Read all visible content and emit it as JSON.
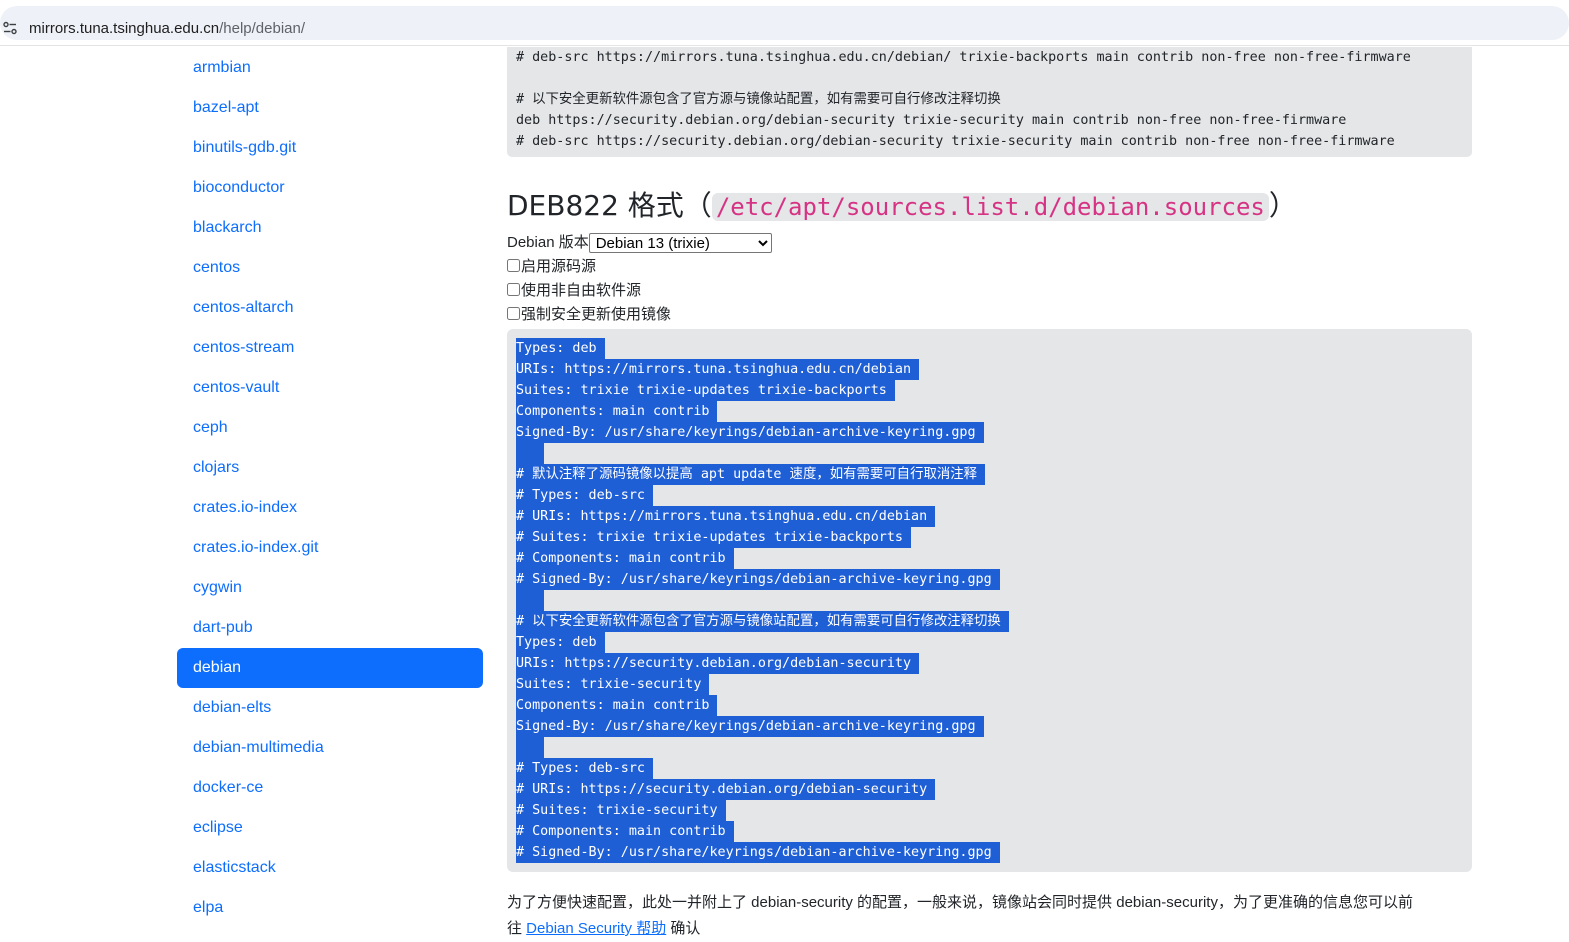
{
  "browser": {
    "url_host": "mirrors.tuna.tsinghua.edu.cn",
    "url_path": "/help/debian/"
  },
  "sidebar": {
    "items": [
      {
        "label": "armbian",
        "active": false
      },
      {
        "label": "bazel-apt",
        "active": false
      },
      {
        "label": "binutils-gdb.git",
        "active": false
      },
      {
        "label": "bioconductor",
        "active": false
      },
      {
        "label": "blackarch",
        "active": false
      },
      {
        "label": "centos",
        "active": false
      },
      {
        "label": "centos-altarch",
        "active": false
      },
      {
        "label": "centos-stream",
        "active": false
      },
      {
        "label": "centos-vault",
        "active": false
      },
      {
        "label": "ceph",
        "active": false
      },
      {
        "label": "clojars",
        "active": false
      },
      {
        "label": "crates.io-index",
        "active": false
      },
      {
        "label": "crates.io-index.git",
        "active": false
      },
      {
        "label": "cygwin",
        "active": false
      },
      {
        "label": "dart-pub",
        "active": false
      },
      {
        "label": "debian",
        "active": true
      },
      {
        "label": "debian-elts",
        "active": false
      },
      {
        "label": "debian-multimedia",
        "active": false
      },
      {
        "label": "docker-ce",
        "active": false
      },
      {
        "label": "eclipse",
        "active": false
      },
      {
        "label": "elasticstack",
        "active": false
      },
      {
        "label": "elpa",
        "active": false
      }
    ]
  },
  "top_code": {
    "lines": [
      "# deb-src https://mirrors.tuna.tsinghua.edu.cn/debian/ trixie-backports main contrib non-free non-free-firmware",
      "",
      "# 以下安全更新软件源包含了官方源与镜像站配置，如有需要可自行修改注释切换",
      "deb https://security.debian.org/debian-security trixie-security main contrib non-free non-free-firmware",
      "# deb-src https://security.debian.org/debian-security trixie-security main contrib non-free non-free-firmware"
    ]
  },
  "deb822": {
    "heading_prefix": "DEB822 格式（",
    "heading_path": "/etc/apt/sources.list.d/debian.sources",
    "heading_suffix": "）",
    "version_label": "Debian 版本",
    "version_selected": "Debian 13 (trixie)",
    "checkboxes": [
      {
        "label": "启用源码源",
        "checked": false
      },
      {
        "label": "使用非自由软件源",
        "checked": false
      },
      {
        "label": "强制安全更新使用镜像",
        "checked": false
      }
    ],
    "code_lines": [
      "Types: deb",
      "URIs: https://mirrors.tuna.tsinghua.edu.cn/debian",
      "Suites: trixie trixie-updates trixie-backports",
      "Components: main contrib",
      "Signed-By: /usr/share/keyrings/debian-archive-keyring.gpg",
      "",
      "# 默认注释了源码镜像以提高 apt update 速度，如有需要可自行取消注释",
      "# Types: deb-src",
      "# URIs: https://mirrors.tuna.tsinghua.edu.cn/debian",
      "# Suites: trixie trixie-updates trixie-backports",
      "# Components: main contrib",
      "# Signed-By: /usr/share/keyrings/debian-archive-keyring.gpg",
      "",
      "# 以下安全更新软件源包含了官方源与镜像站配置，如有需要可自行修改注释切换",
      "Types: deb",
      "URIs: https://security.debian.org/debian-security",
      "Suites: trixie-security",
      "Components: main contrib",
      "Signed-By: /usr/share/keyrings/debian-archive-keyring.gpg",
      "",
      "# Types: deb-src",
      "# URIs: https://security.debian.org/debian-security",
      "# Suites: trixie-security",
      "# Components: main contrib",
      "# Signed-By: /usr/share/keyrings/debian-archive-keyring.gpg"
    ]
  },
  "footnote": {
    "line1": "为了方便快速配置，此处一并附上了 debian-security 的配置，一般来说，镜像站会同时提供 debian-security，为了更准确的信息您可以前",
    "line2_prefix": "往 ",
    "link": "Debian Security 帮助",
    "line2_suffix": " 确认"
  },
  "colors": {
    "accent": "#0d6efd",
    "selection": "#1f5fd6",
    "code_bg": "#e5e6e8",
    "path_code": "#d63384"
  }
}
